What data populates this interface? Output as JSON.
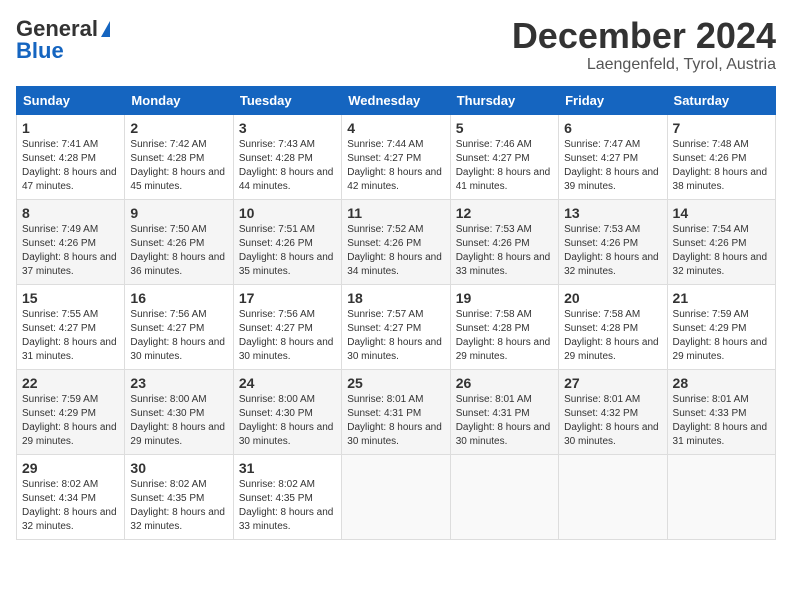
{
  "header": {
    "logo_general": "General",
    "logo_blue": "Blue",
    "month_title": "December 2024",
    "location": "Laengenfeld, Tyrol, Austria"
  },
  "weekdays": [
    "Sunday",
    "Monday",
    "Tuesday",
    "Wednesday",
    "Thursday",
    "Friday",
    "Saturday"
  ],
  "weeks": [
    [
      {
        "day": "1",
        "sunrise": "7:41 AM",
        "sunset": "4:28 PM",
        "daylight": "8 hours and 47 minutes."
      },
      {
        "day": "2",
        "sunrise": "7:42 AM",
        "sunset": "4:28 PM",
        "daylight": "8 hours and 45 minutes."
      },
      {
        "day": "3",
        "sunrise": "7:43 AM",
        "sunset": "4:28 PM",
        "daylight": "8 hours and 44 minutes."
      },
      {
        "day": "4",
        "sunrise": "7:44 AM",
        "sunset": "4:27 PM",
        "daylight": "8 hours and 42 minutes."
      },
      {
        "day": "5",
        "sunrise": "7:46 AM",
        "sunset": "4:27 PM",
        "daylight": "8 hours and 41 minutes."
      },
      {
        "day": "6",
        "sunrise": "7:47 AM",
        "sunset": "4:27 PM",
        "daylight": "8 hours and 39 minutes."
      },
      {
        "day": "7",
        "sunrise": "7:48 AM",
        "sunset": "4:26 PM",
        "daylight": "8 hours and 38 minutes."
      }
    ],
    [
      {
        "day": "8",
        "sunrise": "7:49 AM",
        "sunset": "4:26 PM",
        "daylight": "8 hours and 37 minutes."
      },
      {
        "day": "9",
        "sunrise": "7:50 AM",
        "sunset": "4:26 PM",
        "daylight": "8 hours and 36 minutes."
      },
      {
        "day": "10",
        "sunrise": "7:51 AM",
        "sunset": "4:26 PM",
        "daylight": "8 hours and 35 minutes."
      },
      {
        "day": "11",
        "sunrise": "7:52 AM",
        "sunset": "4:26 PM",
        "daylight": "8 hours and 34 minutes."
      },
      {
        "day": "12",
        "sunrise": "7:53 AM",
        "sunset": "4:26 PM",
        "daylight": "8 hours and 33 minutes."
      },
      {
        "day": "13",
        "sunrise": "7:53 AM",
        "sunset": "4:26 PM",
        "daylight": "8 hours and 32 minutes."
      },
      {
        "day": "14",
        "sunrise": "7:54 AM",
        "sunset": "4:26 PM",
        "daylight": "8 hours and 32 minutes."
      }
    ],
    [
      {
        "day": "15",
        "sunrise": "7:55 AM",
        "sunset": "4:27 PM",
        "daylight": "8 hours and 31 minutes."
      },
      {
        "day": "16",
        "sunrise": "7:56 AM",
        "sunset": "4:27 PM",
        "daylight": "8 hours and 30 minutes."
      },
      {
        "day": "17",
        "sunrise": "7:56 AM",
        "sunset": "4:27 PM",
        "daylight": "8 hours and 30 minutes."
      },
      {
        "day": "18",
        "sunrise": "7:57 AM",
        "sunset": "4:27 PM",
        "daylight": "8 hours and 30 minutes."
      },
      {
        "day": "19",
        "sunrise": "7:58 AM",
        "sunset": "4:28 PM",
        "daylight": "8 hours and 29 minutes."
      },
      {
        "day": "20",
        "sunrise": "7:58 AM",
        "sunset": "4:28 PM",
        "daylight": "8 hours and 29 minutes."
      },
      {
        "day": "21",
        "sunrise": "7:59 AM",
        "sunset": "4:29 PM",
        "daylight": "8 hours and 29 minutes."
      }
    ],
    [
      {
        "day": "22",
        "sunrise": "7:59 AM",
        "sunset": "4:29 PM",
        "daylight": "8 hours and 29 minutes."
      },
      {
        "day": "23",
        "sunrise": "8:00 AM",
        "sunset": "4:30 PM",
        "daylight": "8 hours and 29 minutes."
      },
      {
        "day": "24",
        "sunrise": "8:00 AM",
        "sunset": "4:30 PM",
        "daylight": "8 hours and 30 minutes."
      },
      {
        "day": "25",
        "sunrise": "8:01 AM",
        "sunset": "4:31 PM",
        "daylight": "8 hours and 30 minutes."
      },
      {
        "day": "26",
        "sunrise": "8:01 AM",
        "sunset": "4:31 PM",
        "daylight": "8 hours and 30 minutes."
      },
      {
        "day": "27",
        "sunrise": "8:01 AM",
        "sunset": "4:32 PM",
        "daylight": "8 hours and 30 minutes."
      },
      {
        "day": "28",
        "sunrise": "8:01 AM",
        "sunset": "4:33 PM",
        "daylight": "8 hours and 31 minutes."
      }
    ],
    [
      {
        "day": "29",
        "sunrise": "8:02 AM",
        "sunset": "4:34 PM",
        "daylight": "8 hours and 32 minutes."
      },
      {
        "day": "30",
        "sunrise": "8:02 AM",
        "sunset": "4:35 PM",
        "daylight": "8 hours and 32 minutes."
      },
      {
        "day": "31",
        "sunrise": "8:02 AM",
        "sunset": "4:35 PM",
        "daylight": "8 hours and 33 minutes."
      },
      null,
      null,
      null,
      null
    ]
  ]
}
